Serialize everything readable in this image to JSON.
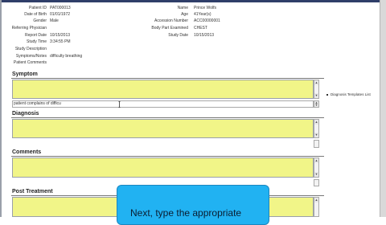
{
  "patient_info": {
    "left": [
      {
        "label": "Patient ID",
        "value": "PAT000013"
      },
      {
        "label": "Date of Birth",
        "value": "01/01/1972"
      },
      {
        "label": "Gender",
        "value": "Male"
      },
      {
        "label": "Referring Physician",
        "value": ""
      },
      {
        "label": "Report Date",
        "value": "10/15/2013"
      },
      {
        "label": "Study Time",
        "value": "3:34:55 PM"
      },
      {
        "label": "Study Description",
        "value": ""
      },
      {
        "label": "Symptoms/Notes",
        "value": "difficulty breathing"
      },
      {
        "label": "Patient Comments",
        "value": ""
      }
    ],
    "right": [
      {
        "label": "Name",
        "value": "Prince Wolfs"
      },
      {
        "label": "Age",
        "value": "41Year(s)"
      },
      {
        "label": "Accession Number",
        "value": "ACC00000001"
      },
      {
        "label": "Body Part Examined",
        "value": "CHEST"
      },
      {
        "label": "Study Date",
        "value": "10/15/2013"
      }
    ]
  },
  "sections": {
    "symptom": {
      "title": "Symptom",
      "value": "",
      "entry_text": "patient complains of difficu"
    },
    "diagnosis": {
      "title": "Diagnosis",
      "value": ""
    },
    "comments": {
      "title": "Comments",
      "value": ""
    },
    "post_treatment": {
      "title": "Post Treatment",
      "value": ""
    }
  },
  "diagnosis_templates_link": "Diagnosis Templates List",
  "scroll_arrows": {
    "up": "▲",
    "down": "▼"
  },
  "callout": {
    "text": "Next, type the appropriate"
  },
  "colors": {
    "field_bg": "#f1f588",
    "callout_bg": "#21b2f2",
    "title_bar": "#2f3e69"
  }
}
